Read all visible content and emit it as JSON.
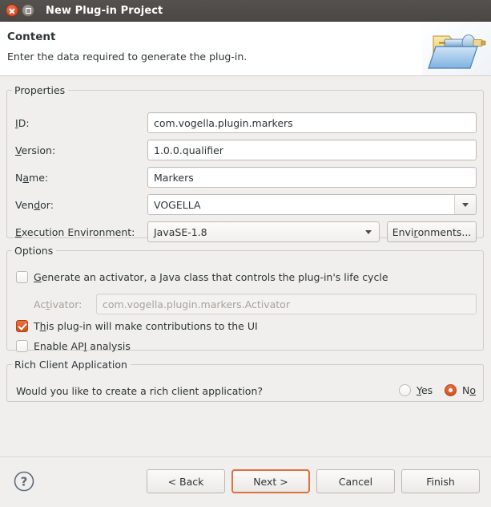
{
  "window": {
    "title": "New Plug-in Project",
    "close_icon": "close-icon",
    "maximize_icon": "maximize-icon"
  },
  "header": {
    "title": "Content",
    "description": "Enter the data required to generate the plug-in.",
    "banner_icon": "plugin-folder-banner-icon"
  },
  "properties": {
    "legend": "Properties",
    "id": {
      "label_pre": "",
      "label_mnemonic": "I",
      "label_post": "D:",
      "value": "com.vogella.plugin.markers"
    },
    "version": {
      "label_pre": "",
      "label_mnemonic": "V",
      "label_post": "ersion:",
      "value": "1.0.0.qualifier"
    },
    "name": {
      "label_pre": "N",
      "label_mnemonic": "a",
      "label_post": "me:",
      "value": "Markers"
    },
    "vendor": {
      "label_pre": "Ven",
      "label_mnemonic": "d",
      "label_post": "or:",
      "value": "VOGELLA"
    },
    "execution_environment": {
      "label_pre": "",
      "label_mnemonic": "E",
      "label_post": "xecution Environment:",
      "value": "JavaSE-1.8",
      "button_pre": "Envi",
      "button_mnemonic": "r",
      "button_post": "onments..."
    }
  },
  "options": {
    "legend": "Options",
    "generate_activator": {
      "pre": "",
      "mnemonic": "G",
      "post": "enerate an activator, a Java class that controls the plug-in's life cycle",
      "checked": false
    },
    "activator": {
      "label_pre": "Ac",
      "label_mnemonic": "t",
      "label_post": "ivator:",
      "value": "com.vogella.plugin.markers.Activator",
      "disabled": true
    },
    "ui_contributions": {
      "pre": "T",
      "mnemonic": "h",
      "post": "is plug-in will make contributions to the UI",
      "checked": true
    },
    "api_analysis": {
      "pre": "Enable AP",
      "mnemonic": "I",
      "post": " analysis",
      "checked": false
    }
  },
  "rich_client": {
    "legend": "Rich Client Application",
    "question": "Would you like to create a rich client application?",
    "yes": {
      "pre": "",
      "mnemonic": "Y",
      "post": "es",
      "selected": false
    },
    "no": {
      "pre": "N",
      "mnemonic": "o",
      "post": "",
      "selected": true
    }
  },
  "buttonbar": {
    "help_icon": "help-icon",
    "back": "< Back",
    "next": "Next >",
    "cancel": "Cancel",
    "finish": "Finish",
    "default_button": "Next >"
  },
  "colors": {
    "accent": "#d2521f",
    "titlebar": "#4c4a46",
    "background": "#f0efee",
    "header_background": "#ffffff",
    "text": "#2e3436",
    "disabled_text": "#a7a29b"
  }
}
